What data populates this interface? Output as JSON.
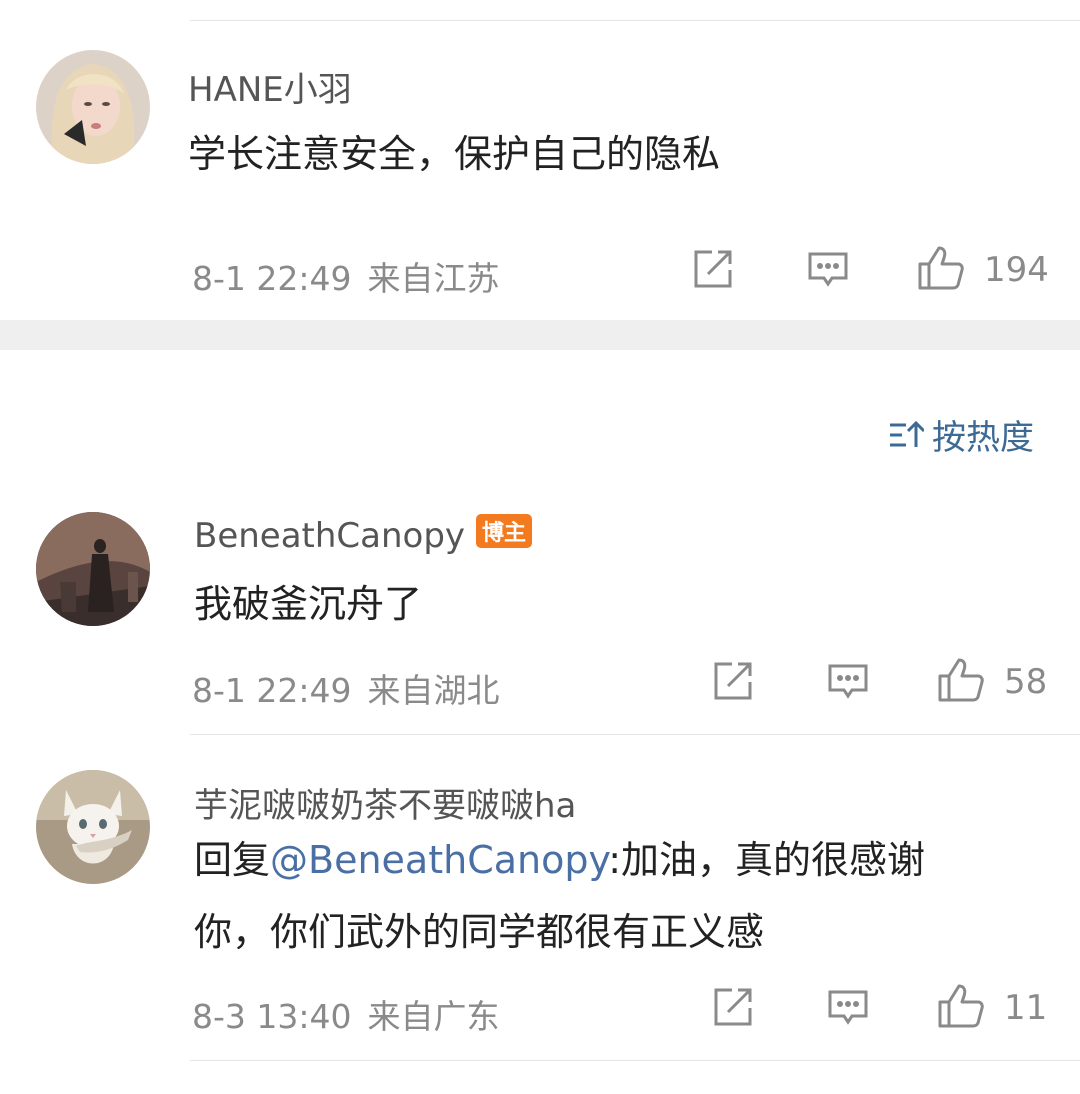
{
  "comments": [
    {
      "username": "HANE小羽",
      "content": "学长注意安全，保护自己的隐私",
      "time": "8-1 22:49",
      "location": "来自江苏",
      "likes": "194",
      "avatar": "avatar-blonde-woman"
    },
    {
      "username": "BeneathCanopy",
      "badge": "博主",
      "content": "我破釜沉舟了",
      "time": "8-1 22:49",
      "location": "来自湖北",
      "likes": "58",
      "avatar": "avatar-stage-performer"
    },
    {
      "username": "芋泥啵啵奶茶不要啵啵ha",
      "reply_prefix": "回复",
      "mention": "@BeneathCanopy",
      "content_line1": ":加油，真的很感谢",
      "content_line2": "你，你们武外的同学都很有正义感",
      "time": "8-3 13:40",
      "location": "来自广东",
      "likes": "11",
      "avatar": "avatar-white-cat"
    }
  ],
  "sort": {
    "label": "按热度",
    "icon": "sort-icon"
  },
  "icons": {
    "share": "share-icon",
    "comment": "comment-icon",
    "like": "thumbs-up-icon"
  },
  "colors": {
    "link": "#4a6fa5",
    "sort": "#3d6a94",
    "badge": "#f47a1f",
    "meta": "#8a8a8a"
  }
}
